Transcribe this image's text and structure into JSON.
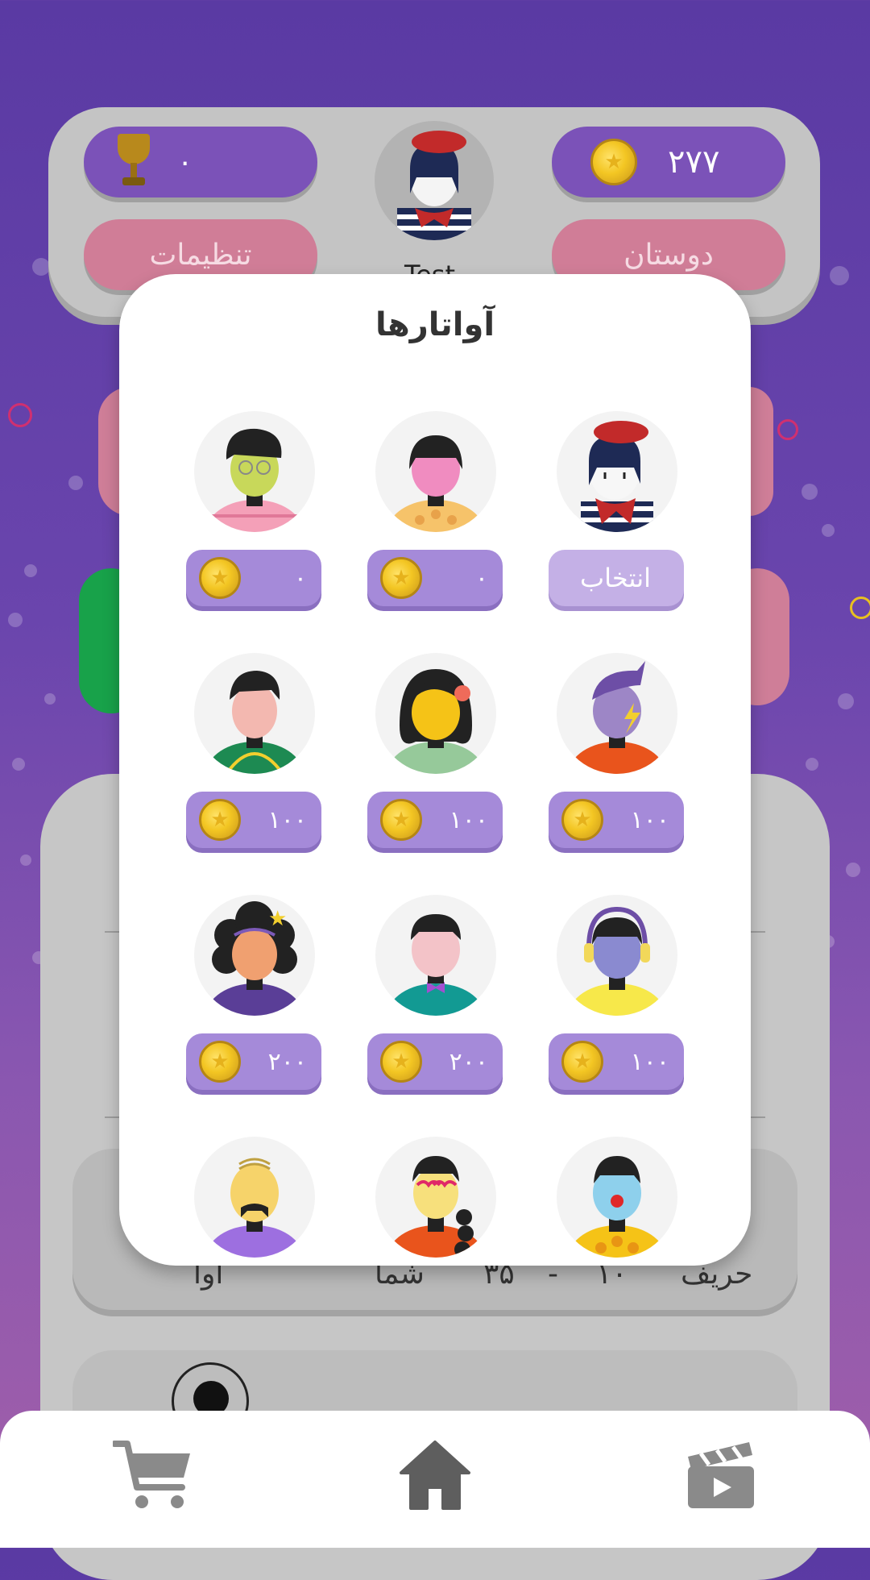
{
  "header": {
    "trophy_count": "۰",
    "coins": "۲۷۷",
    "settings_label": "تنظیمات",
    "friends_label": "دوستان",
    "username": "Test"
  },
  "background": {
    "score_opponent_label": "حریف",
    "score_opponent": "۱۰",
    "score_dash": "-",
    "score_you": "۳۵",
    "you_label": "شما",
    "player_name": "اوا"
  },
  "modal": {
    "title": "آواتارها",
    "avatars": [
      {
        "name": "mime-avatar",
        "action": "انتخاب",
        "selectable": true
      },
      {
        "name": "pink-girl-avatar",
        "price": "۰"
      },
      {
        "name": "green-boy-avatar",
        "price": "۰"
      },
      {
        "name": "purple-lightning-avatar",
        "price": "۱۰۰"
      },
      {
        "name": "yellow-flower-girl-avatar",
        "price": "۱۰۰"
      },
      {
        "name": "green-shirt-boy-avatar",
        "price": "۱۰۰"
      },
      {
        "name": "headphones-girl-avatar",
        "price": "۱۰۰"
      },
      {
        "name": "bowtie-boy-avatar",
        "price": "۲۰۰"
      },
      {
        "name": "curly-star-girl-avatar",
        "price": "۲۰۰"
      },
      {
        "name": "clown-avatar"
      },
      {
        "name": "heart-glasses-girl-avatar"
      },
      {
        "name": "mustache-man-avatar"
      }
    ]
  },
  "nav": {
    "items": [
      "cart-icon",
      "home-icon",
      "video-icon"
    ]
  }
}
